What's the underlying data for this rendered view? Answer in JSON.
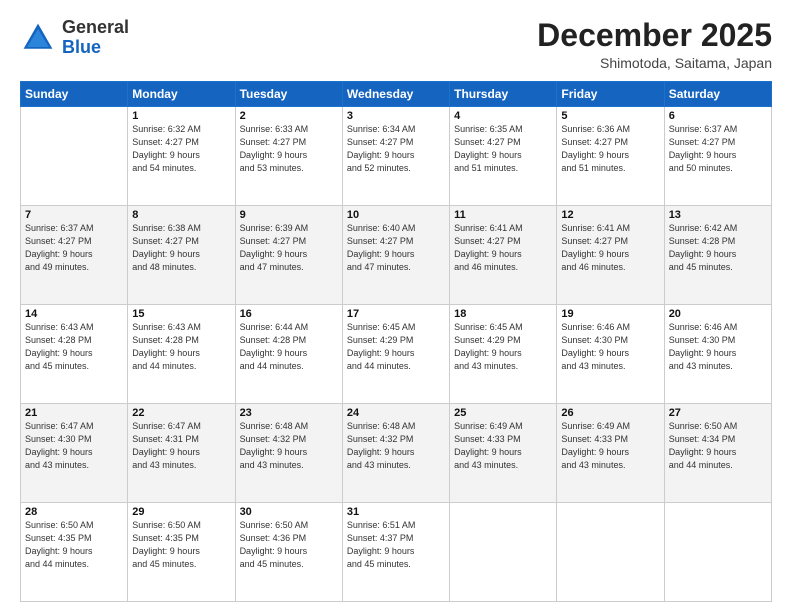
{
  "logo": {
    "line1": "General",
    "line2": "Blue"
  },
  "header": {
    "month_year": "December 2025",
    "location": "Shimotoda, Saitama, Japan"
  },
  "weekdays": [
    "Sunday",
    "Monday",
    "Tuesday",
    "Wednesday",
    "Thursday",
    "Friday",
    "Saturday"
  ],
  "weeks": [
    [
      {
        "day": "",
        "sunrise": "",
        "sunset": "",
        "daylight": ""
      },
      {
        "day": "1",
        "sunrise": "Sunrise: 6:32 AM",
        "sunset": "Sunset: 4:27 PM",
        "daylight": "Daylight: 9 hours and 54 minutes."
      },
      {
        "day": "2",
        "sunrise": "Sunrise: 6:33 AM",
        "sunset": "Sunset: 4:27 PM",
        "daylight": "Daylight: 9 hours and 53 minutes."
      },
      {
        "day": "3",
        "sunrise": "Sunrise: 6:34 AM",
        "sunset": "Sunset: 4:27 PM",
        "daylight": "Daylight: 9 hours and 52 minutes."
      },
      {
        "day": "4",
        "sunrise": "Sunrise: 6:35 AM",
        "sunset": "Sunset: 4:27 PM",
        "daylight": "Daylight: 9 hours and 51 minutes."
      },
      {
        "day": "5",
        "sunrise": "Sunrise: 6:36 AM",
        "sunset": "Sunset: 4:27 PM",
        "daylight": "Daylight: 9 hours and 51 minutes."
      },
      {
        "day": "6",
        "sunrise": "Sunrise: 6:37 AM",
        "sunset": "Sunset: 4:27 PM",
        "daylight": "Daylight: 9 hours and 50 minutes."
      }
    ],
    [
      {
        "day": "7",
        "sunrise": "Sunrise: 6:37 AM",
        "sunset": "Sunset: 4:27 PM",
        "daylight": "Daylight: 9 hours and 49 minutes."
      },
      {
        "day": "8",
        "sunrise": "Sunrise: 6:38 AM",
        "sunset": "Sunset: 4:27 PM",
        "daylight": "Daylight: 9 hours and 48 minutes."
      },
      {
        "day": "9",
        "sunrise": "Sunrise: 6:39 AM",
        "sunset": "Sunset: 4:27 PM",
        "daylight": "Daylight: 9 hours and 47 minutes."
      },
      {
        "day": "10",
        "sunrise": "Sunrise: 6:40 AM",
        "sunset": "Sunset: 4:27 PM",
        "daylight": "Daylight: 9 hours and 47 minutes."
      },
      {
        "day": "11",
        "sunrise": "Sunrise: 6:41 AM",
        "sunset": "Sunset: 4:27 PM",
        "daylight": "Daylight: 9 hours and 46 minutes."
      },
      {
        "day": "12",
        "sunrise": "Sunrise: 6:41 AM",
        "sunset": "Sunset: 4:27 PM",
        "daylight": "Daylight: 9 hours and 46 minutes."
      },
      {
        "day": "13",
        "sunrise": "Sunrise: 6:42 AM",
        "sunset": "Sunset: 4:28 PM",
        "daylight": "Daylight: 9 hours and 45 minutes."
      }
    ],
    [
      {
        "day": "14",
        "sunrise": "Sunrise: 6:43 AM",
        "sunset": "Sunset: 4:28 PM",
        "daylight": "Daylight: 9 hours and 45 minutes."
      },
      {
        "day": "15",
        "sunrise": "Sunrise: 6:43 AM",
        "sunset": "Sunset: 4:28 PM",
        "daylight": "Daylight: 9 hours and 44 minutes."
      },
      {
        "day": "16",
        "sunrise": "Sunrise: 6:44 AM",
        "sunset": "Sunset: 4:28 PM",
        "daylight": "Daylight: 9 hours and 44 minutes."
      },
      {
        "day": "17",
        "sunrise": "Sunrise: 6:45 AM",
        "sunset": "Sunset: 4:29 PM",
        "daylight": "Daylight: 9 hours and 44 minutes."
      },
      {
        "day": "18",
        "sunrise": "Sunrise: 6:45 AM",
        "sunset": "Sunset: 4:29 PM",
        "daylight": "Daylight: 9 hours and 43 minutes."
      },
      {
        "day": "19",
        "sunrise": "Sunrise: 6:46 AM",
        "sunset": "Sunset: 4:30 PM",
        "daylight": "Daylight: 9 hours and 43 minutes."
      },
      {
        "day": "20",
        "sunrise": "Sunrise: 6:46 AM",
        "sunset": "Sunset: 4:30 PM",
        "daylight": "Daylight: 9 hours and 43 minutes."
      }
    ],
    [
      {
        "day": "21",
        "sunrise": "Sunrise: 6:47 AM",
        "sunset": "Sunset: 4:30 PM",
        "daylight": "Daylight: 9 hours and 43 minutes."
      },
      {
        "day": "22",
        "sunrise": "Sunrise: 6:47 AM",
        "sunset": "Sunset: 4:31 PM",
        "daylight": "Daylight: 9 hours and 43 minutes."
      },
      {
        "day": "23",
        "sunrise": "Sunrise: 6:48 AM",
        "sunset": "Sunset: 4:32 PM",
        "daylight": "Daylight: 9 hours and 43 minutes."
      },
      {
        "day": "24",
        "sunrise": "Sunrise: 6:48 AM",
        "sunset": "Sunset: 4:32 PM",
        "daylight": "Daylight: 9 hours and 43 minutes."
      },
      {
        "day": "25",
        "sunrise": "Sunrise: 6:49 AM",
        "sunset": "Sunset: 4:33 PM",
        "daylight": "Daylight: 9 hours and 43 minutes."
      },
      {
        "day": "26",
        "sunrise": "Sunrise: 6:49 AM",
        "sunset": "Sunset: 4:33 PM",
        "daylight": "Daylight: 9 hours and 43 minutes."
      },
      {
        "day": "27",
        "sunrise": "Sunrise: 6:50 AM",
        "sunset": "Sunset: 4:34 PM",
        "daylight": "Daylight: 9 hours and 44 minutes."
      }
    ],
    [
      {
        "day": "28",
        "sunrise": "Sunrise: 6:50 AM",
        "sunset": "Sunset: 4:35 PM",
        "daylight": "Daylight: 9 hours and 44 minutes."
      },
      {
        "day": "29",
        "sunrise": "Sunrise: 6:50 AM",
        "sunset": "Sunset: 4:35 PM",
        "daylight": "Daylight: 9 hours and 45 minutes."
      },
      {
        "day": "30",
        "sunrise": "Sunrise: 6:50 AM",
        "sunset": "Sunset: 4:36 PM",
        "daylight": "Daylight: 9 hours and 45 minutes."
      },
      {
        "day": "31",
        "sunrise": "Sunrise: 6:51 AM",
        "sunset": "Sunset: 4:37 PM",
        "daylight": "Daylight: 9 hours and 45 minutes."
      },
      {
        "day": "",
        "sunrise": "",
        "sunset": "",
        "daylight": ""
      },
      {
        "day": "",
        "sunrise": "",
        "sunset": "",
        "daylight": ""
      },
      {
        "day": "",
        "sunrise": "",
        "sunset": "",
        "daylight": ""
      }
    ]
  ]
}
